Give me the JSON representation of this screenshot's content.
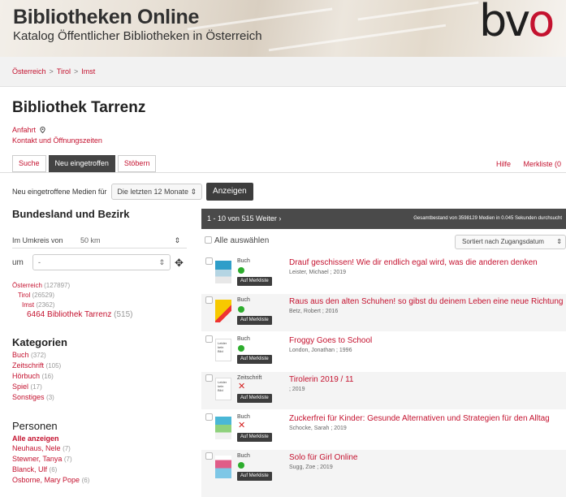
{
  "header": {
    "title": "Bibliotheken Online",
    "subtitle": "Katalog Öffentlicher Bibliotheken in Österreich",
    "logo_main": "bv",
    "logo_accent": "o"
  },
  "breadcrumb": [
    "Österreich",
    "Tirol",
    "Imst"
  ],
  "breadcrumb_sep": ">",
  "library": {
    "name": "Bibliothek Tarrenz",
    "directions": "Anfahrt",
    "contact": "Kontakt und Öffnungszeiten"
  },
  "tabs": [
    "Suche",
    "Neu eingetroffen",
    "Stöbern"
  ],
  "top_links": {
    "help": "Hilfe",
    "merkliste": "Merkliste (0"
  },
  "new_media": {
    "label": "Neu eingetroffene Medien für",
    "period": "Die letzten 12 Monate",
    "button": "Anzeigen"
  },
  "sidebar": {
    "region_heading": "Bundesland und Bezirk",
    "radius_label": "Im Umkreis von",
    "radius_value": "50 km",
    "um_label": "um",
    "um_value": "-",
    "tree": [
      {
        "label": "Österreich",
        "count": "(127897)"
      },
      {
        "label": "Tirol",
        "count": "(26529)"
      },
      {
        "label": "Imst",
        "count": "(2362)"
      },
      {
        "label": "6464 Bibliothek Tarrenz",
        "count": "(515)"
      }
    ],
    "categories_heading": "Kategorien",
    "categories": [
      {
        "label": "Buch",
        "count": "(372)"
      },
      {
        "label": "Zeitschrift",
        "count": "(105)"
      },
      {
        "label": "Hörbuch",
        "count": "(16)"
      },
      {
        "label": "Spiel",
        "count": "(17)"
      },
      {
        "label": "Sonstiges",
        "count": "(3)"
      }
    ],
    "persons_heading": "Personen",
    "persons_all": "Alle anzeigen",
    "persons": [
      {
        "label": "Neuhaus, Nele",
        "count": "(7)"
      },
      {
        "label": "Stewner, Tanya",
        "count": "(7)"
      },
      {
        "label": "Blanck, Ulf",
        "count": "(6)"
      },
      {
        "label": "Osborne, Mary Pope",
        "count": "(6)"
      }
    ]
  },
  "results": {
    "range": "1 - 10 von 515 Weiter ›",
    "summary": "Gesamtbestand von 3598129 Medien in 0.045 Sekunden durchsucht",
    "select_all": "Alle auswählen",
    "sort": "Sortiert nach Zugangsdatum",
    "merkliste_button": "Auf Merkliste",
    "items": [
      {
        "type": "Buch",
        "available": "green",
        "title": "Drauf geschissen! Wie dir endlich egal wird, was die anderen denken",
        "author": "Leister, Michael ; 2019"
      },
      {
        "type": "Buch",
        "available": "green",
        "title": "Raus aus den alten Schuhen! so gibst du deinem Leben eine neue Richtung",
        "author": "Betz, Robert ; 2016"
      },
      {
        "type": "Buch",
        "available": "green",
        "title": "Froggy Goes to School",
        "author": "London, Jonathan ; 1996",
        "cover_text": "Leider kein Bild"
      },
      {
        "type": "Zeitschrift",
        "available": "red",
        "title": "Tirolerin 2019 / 11",
        "author": "; 2019",
        "cover_text": "Leider kein Bild"
      },
      {
        "type": "Buch",
        "available": "red",
        "title": "Zuckerfrei für Kinder: Gesunde Alternativen und Strategien für den Alltag",
        "author": "Schocke, Sarah ; 2019"
      },
      {
        "type": "Buch",
        "available": "green",
        "title": "Solo für Girl Online",
        "author": "Sugg, Zoe ; 2019"
      }
    ]
  },
  "colors": {
    "accent": "#c4122f",
    "dark": "#444444",
    "available": "#2dad2d",
    "unavailable": "#d42020"
  },
  "icons": {
    "directions": "map-pin-icon",
    "locate": "crosshair-icon",
    "unavailable": "cross-icon"
  }
}
